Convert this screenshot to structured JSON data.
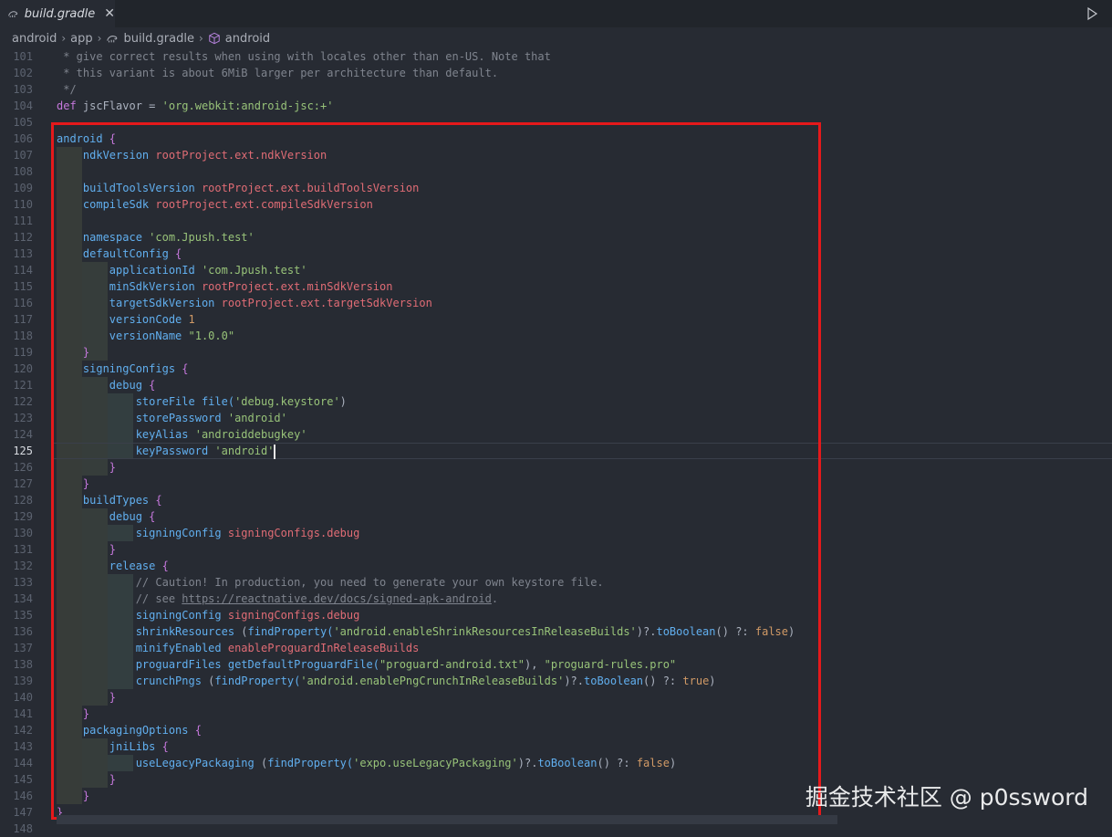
{
  "tab": {
    "title": "build.gradle",
    "close_glyph": "✕"
  },
  "breadcrumb": {
    "items": [
      "android",
      "app",
      "build.gradle",
      "android"
    ],
    "separator": "›"
  },
  "colors": {
    "highlight_box": "#e5191b",
    "keyword": "#61afef",
    "property": "#e06c75",
    "string": "#98c379"
  },
  "watermark": "掘金技术社区 @ p0ssword",
  "active_line": 125,
  "editor": {
    "lines": [
      {
        "n": "101",
        "tokens": [
          {
            "t": " * give correct results when using with locales other than en-US. Note that",
            "c": "cmt"
          }
        ]
      },
      {
        "n": "102",
        "tokens": [
          {
            "t": " * this variant is about 6MiB larger per architecture than default.",
            "c": "cmt"
          }
        ]
      },
      {
        "n": "103",
        "tokens": [
          {
            "t": " */",
            "c": "cmt"
          }
        ]
      },
      {
        "n": "104",
        "tokens": [
          {
            "t": "def ",
            "c": "def"
          },
          {
            "t": "jscFlavor",
            "c": "var"
          },
          {
            "t": " = ",
            "c": "var"
          },
          {
            "t": "'org.webkit:android-jsc:+'",
            "c": "str"
          }
        ]
      },
      {
        "n": "105",
        "tokens": []
      },
      {
        "n": "106",
        "tokens": [
          {
            "t": "android",
            "c": "kw"
          },
          {
            "t": " {",
            "c": "brace-y"
          }
        ]
      },
      {
        "n": "107",
        "tokens": [
          {
            "t": "    ndkVersion ",
            "c": "kw"
          },
          {
            "t": "rootProject.ext.ndkVersion",
            "c": "prop"
          }
        ]
      },
      {
        "n": "108",
        "tokens": []
      },
      {
        "n": "109",
        "tokens": [
          {
            "t": "    buildToolsVersion ",
            "c": "kw"
          },
          {
            "t": "rootProject.ext.buildToolsVersion",
            "c": "prop"
          }
        ]
      },
      {
        "n": "110",
        "tokens": [
          {
            "t": "    compileSdk ",
            "c": "kw"
          },
          {
            "t": "rootProject.ext.compileSdkVersion",
            "c": "prop"
          }
        ]
      },
      {
        "n": "111",
        "tokens": []
      },
      {
        "n": "112",
        "tokens": [
          {
            "t": "    namespace ",
            "c": "kw"
          },
          {
            "t": "'com.Jpush.test'",
            "c": "str"
          }
        ]
      },
      {
        "n": "113",
        "tokens": [
          {
            "t": "    defaultConfig ",
            "c": "kw"
          },
          {
            "t": "{",
            "c": "brace-y"
          }
        ]
      },
      {
        "n": "114",
        "tokens": [
          {
            "t": "        applicationId ",
            "c": "kw"
          },
          {
            "t": "'com.Jpush.test'",
            "c": "str"
          }
        ]
      },
      {
        "n": "115",
        "tokens": [
          {
            "t": "        minSdkVersion ",
            "c": "kw"
          },
          {
            "t": "rootProject.ext.minSdkVersion",
            "c": "prop"
          }
        ]
      },
      {
        "n": "116",
        "tokens": [
          {
            "t": "        targetSdkVersion ",
            "c": "kw"
          },
          {
            "t": "rootProject.ext.targetSdkVersion",
            "c": "prop"
          }
        ]
      },
      {
        "n": "117",
        "tokens": [
          {
            "t": "        versionCode ",
            "c": "kw"
          },
          {
            "t": "1",
            "c": "num"
          }
        ]
      },
      {
        "n": "118",
        "tokens": [
          {
            "t": "        versionName ",
            "c": "kw"
          },
          {
            "t": "\"1.0.0\"",
            "c": "str"
          }
        ]
      },
      {
        "n": "119",
        "tokens": [
          {
            "t": "    }",
            "c": "brace-y"
          }
        ]
      },
      {
        "n": "120",
        "tokens": [
          {
            "t": "    signingConfigs ",
            "c": "kw"
          },
          {
            "t": "{",
            "c": "brace-y"
          }
        ]
      },
      {
        "n": "121",
        "tokens": [
          {
            "t": "        debug ",
            "c": "kw"
          },
          {
            "t": "{",
            "c": "brace-y"
          }
        ]
      },
      {
        "n": "122",
        "tokens": [
          {
            "t": "            storeFile ",
            "c": "kw"
          },
          {
            "t": "file(",
            "c": "kw"
          },
          {
            "t": "'debug.keystore'",
            "c": "str"
          },
          {
            "t": ")",
            "c": "var"
          }
        ]
      },
      {
        "n": "123",
        "tokens": [
          {
            "t": "            storePassword ",
            "c": "kw"
          },
          {
            "t": "'android'",
            "c": "str"
          }
        ]
      },
      {
        "n": "124",
        "tokens": [
          {
            "t": "            keyAlias ",
            "c": "kw"
          },
          {
            "t": "'androiddebugkey'",
            "c": "str"
          }
        ]
      },
      {
        "n": "125",
        "tokens": [
          {
            "t": "            keyPassword ",
            "c": "kw"
          },
          {
            "t": "'android'",
            "c": "str"
          }
        ],
        "caret": true
      },
      {
        "n": "126",
        "tokens": [
          {
            "t": "        }",
            "c": "brace-y"
          }
        ]
      },
      {
        "n": "127",
        "tokens": [
          {
            "t": "    }",
            "c": "brace-y"
          }
        ]
      },
      {
        "n": "128",
        "tokens": [
          {
            "t": "    buildTypes ",
            "c": "kw"
          },
          {
            "t": "{",
            "c": "brace-y"
          }
        ]
      },
      {
        "n": "129",
        "tokens": [
          {
            "t": "        debug ",
            "c": "kw"
          },
          {
            "t": "{",
            "c": "brace-y"
          }
        ]
      },
      {
        "n": "130",
        "tokens": [
          {
            "t": "            signingConfig ",
            "c": "kw"
          },
          {
            "t": "signingConfigs.debug",
            "c": "prop"
          }
        ]
      },
      {
        "n": "131",
        "tokens": [
          {
            "t": "        }",
            "c": "brace-y"
          }
        ]
      },
      {
        "n": "132",
        "tokens": [
          {
            "t": "        release ",
            "c": "kw"
          },
          {
            "t": "{",
            "c": "brace-y"
          }
        ]
      },
      {
        "n": "133",
        "tokens": [
          {
            "t": "            // Caution! In production, you need to generate your own keystore file.",
            "c": "cmt"
          }
        ]
      },
      {
        "n": "134",
        "tokens": [
          {
            "t": "            // see ",
            "c": "cmt"
          },
          {
            "t": "https://reactnative.dev/docs/signed-apk-android",
            "c": "url"
          },
          {
            "t": ".",
            "c": "cmt"
          }
        ]
      },
      {
        "n": "135",
        "tokens": [
          {
            "t": "            signingConfig ",
            "c": "kw"
          },
          {
            "t": "signingConfigs.debug",
            "c": "prop"
          }
        ]
      },
      {
        "n": "136",
        "tokens": [
          {
            "t": "            shrinkResources ",
            "c": "kw"
          },
          {
            "t": "(",
            "c": "var"
          },
          {
            "t": "findProperty(",
            "c": "kw"
          },
          {
            "t": "'android.enableShrinkResourcesInReleaseBuilds'",
            "c": "str"
          },
          {
            "t": ")?.",
            "c": "var"
          },
          {
            "t": "toBoolean",
            "c": "kw"
          },
          {
            "t": "() ?: ",
            "c": "var"
          },
          {
            "t": "false",
            "c": "num"
          },
          {
            "t": ")",
            "c": "var"
          }
        ]
      },
      {
        "n": "137",
        "tokens": [
          {
            "t": "            minifyEnabled ",
            "c": "kw"
          },
          {
            "t": "enableProguardInReleaseBuilds",
            "c": "prop"
          }
        ]
      },
      {
        "n": "138",
        "tokens": [
          {
            "t": "            proguardFiles ",
            "c": "kw"
          },
          {
            "t": "getDefaultProguardFile(",
            "c": "kw"
          },
          {
            "t": "\"proguard-android.txt\"",
            "c": "str"
          },
          {
            "t": "), ",
            "c": "var"
          },
          {
            "t": "\"proguard-rules.pro\"",
            "c": "str"
          }
        ]
      },
      {
        "n": "139",
        "tokens": [
          {
            "t": "            crunchPngs ",
            "c": "kw"
          },
          {
            "t": "(",
            "c": "var"
          },
          {
            "t": "findProperty(",
            "c": "kw"
          },
          {
            "t": "'android.enablePngCrunchInReleaseBuilds'",
            "c": "str"
          },
          {
            "t": ")?.",
            "c": "var"
          },
          {
            "t": "toBoolean",
            "c": "kw"
          },
          {
            "t": "() ?: ",
            "c": "var"
          },
          {
            "t": "true",
            "c": "num"
          },
          {
            "t": ")",
            "c": "var"
          }
        ]
      },
      {
        "n": "140",
        "tokens": [
          {
            "t": "        }",
            "c": "brace-y"
          }
        ]
      },
      {
        "n": "141",
        "tokens": [
          {
            "t": "    }",
            "c": "brace-y"
          }
        ]
      },
      {
        "n": "142",
        "tokens": [
          {
            "t": "    packagingOptions ",
            "c": "kw"
          },
          {
            "t": "{",
            "c": "brace-y"
          }
        ]
      },
      {
        "n": "143",
        "tokens": [
          {
            "t": "        jniLibs ",
            "c": "kw"
          },
          {
            "t": "{",
            "c": "brace-y"
          }
        ]
      },
      {
        "n": "144",
        "tokens": [
          {
            "t": "            useLegacyPackaging ",
            "c": "kw"
          },
          {
            "t": "(",
            "c": "var"
          },
          {
            "t": "findProperty(",
            "c": "kw"
          },
          {
            "t": "'expo.useLegacyPackaging'",
            "c": "str"
          },
          {
            "t": ")?.",
            "c": "var"
          },
          {
            "t": "toBoolean",
            "c": "kw"
          },
          {
            "t": "() ?: ",
            "c": "var"
          },
          {
            "t": "false",
            "c": "num"
          },
          {
            "t": ")",
            "c": "var"
          }
        ]
      },
      {
        "n": "145",
        "tokens": [
          {
            "t": "        }",
            "c": "brace-y"
          }
        ]
      },
      {
        "n": "146",
        "tokens": [
          {
            "t": "    }",
            "c": "brace-y"
          }
        ]
      },
      {
        "n": "147",
        "tokens": [
          {
            "t": "}",
            "c": "brace-y"
          }
        ]
      },
      {
        "n": "148",
        "tokens": []
      }
    ]
  }
}
